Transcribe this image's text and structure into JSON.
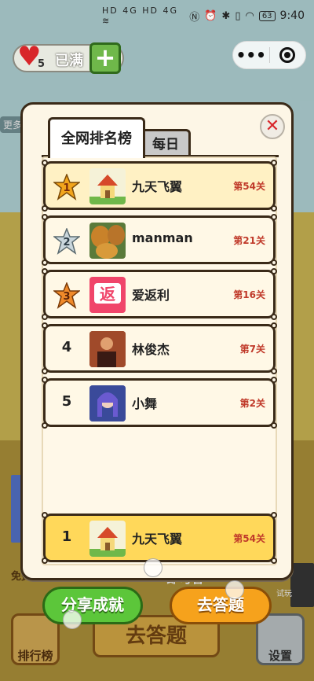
{
  "status_bar": {
    "left_icons": "HD 4G HD 4G ≋",
    "battery": "63",
    "time": "9:40"
  },
  "background": {
    "more_label": "更多",
    "free_label": "免费能",
    "hint_label": "即可答",
    "ranking_button": "排行榜",
    "answer_button": "去答题",
    "settings_button": "设置",
    "trial_label": "试玩"
  },
  "hearts": {
    "count": "5",
    "status": "已满",
    "plus": "+"
  },
  "capsule": {
    "more": "•••"
  },
  "modal": {
    "tab_all": "全网排名榜",
    "tab_daily": "每日",
    "close": "✕",
    "rows": [
      {
        "rank": "1",
        "name": "九天飞翼",
        "level": "第54关",
        "badge": "gold"
      },
      {
        "rank": "2",
        "name": "manman",
        "level": "第21关",
        "badge": "silver"
      },
      {
        "rank": "3",
        "name": "爱返利",
        "level": "第16关",
        "badge": "bronze"
      },
      {
        "rank": "4",
        "name": "林俊杰",
        "level": "第7关",
        "badge": ""
      },
      {
        "rank": "5",
        "name": "小舞",
        "level": "第2关",
        "badge": ""
      }
    ],
    "my_row": {
      "rank": "1",
      "name": "九天飞翼",
      "level": "第54关"
    }
  },
  "actions": {
    "share": "分享成就",
    "answer": "去答题"
  },
  "colors": {
    "gold_badge": "#f2a51c",
    "silver_badge": "#b8c6cc",
    "bronze_badge": "#f08a2a",
    "level_red": "#c03a2a",
    "share_green": "#5cc63a",
    "answer_orange": "#f6a21c"
  }
}
